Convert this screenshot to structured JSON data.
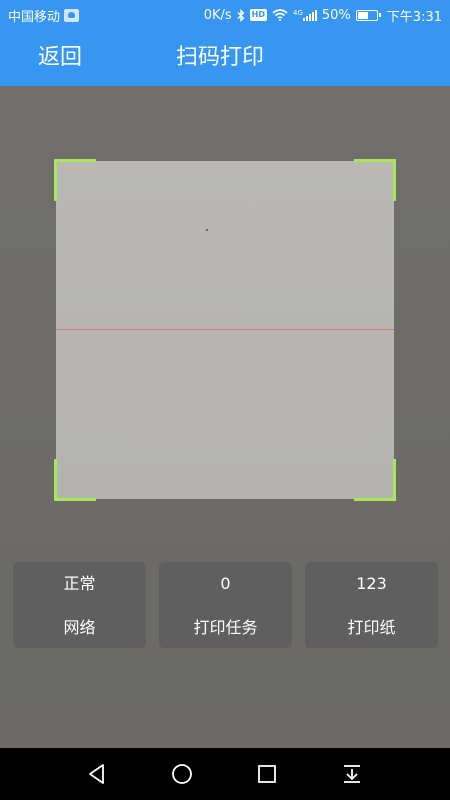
{
  "status_bar": {
    "carrier": "中国移动",
    "speed": "0K/s",
    "network_type": "4G",
    "battery": "50%",
    "time": "下午3:31",
    "icons": [
      "carrier-app-icon",
      "bluetooth-icon",
      "hd-icon",
      "wifi-icon",
      "signal-icon",
      "battery-icon"
    ]
  },
  "header": {
    "back_label": "返回",
    "title": "扫码打印",
    "color": "#3796ef"
  },
  "scanner": {
    "corner_color": "#a8e65a",
    "scan_line_color": "#d9776f"
  },
  "cards": [
    {
      "value": "正常",
      "label": "网络"
    },
    {
      "value": "0",
      "label": "打印任务"
    },
    {
      "value": "123",
      "label": "打印纸"
    }
  ],
  "nav": {
    "icons": [
      "back-triangle-icon",
      "home-circle-icon",
      "recents-square-icon",
      "notification-pull-icon"
    ]
  }
}
